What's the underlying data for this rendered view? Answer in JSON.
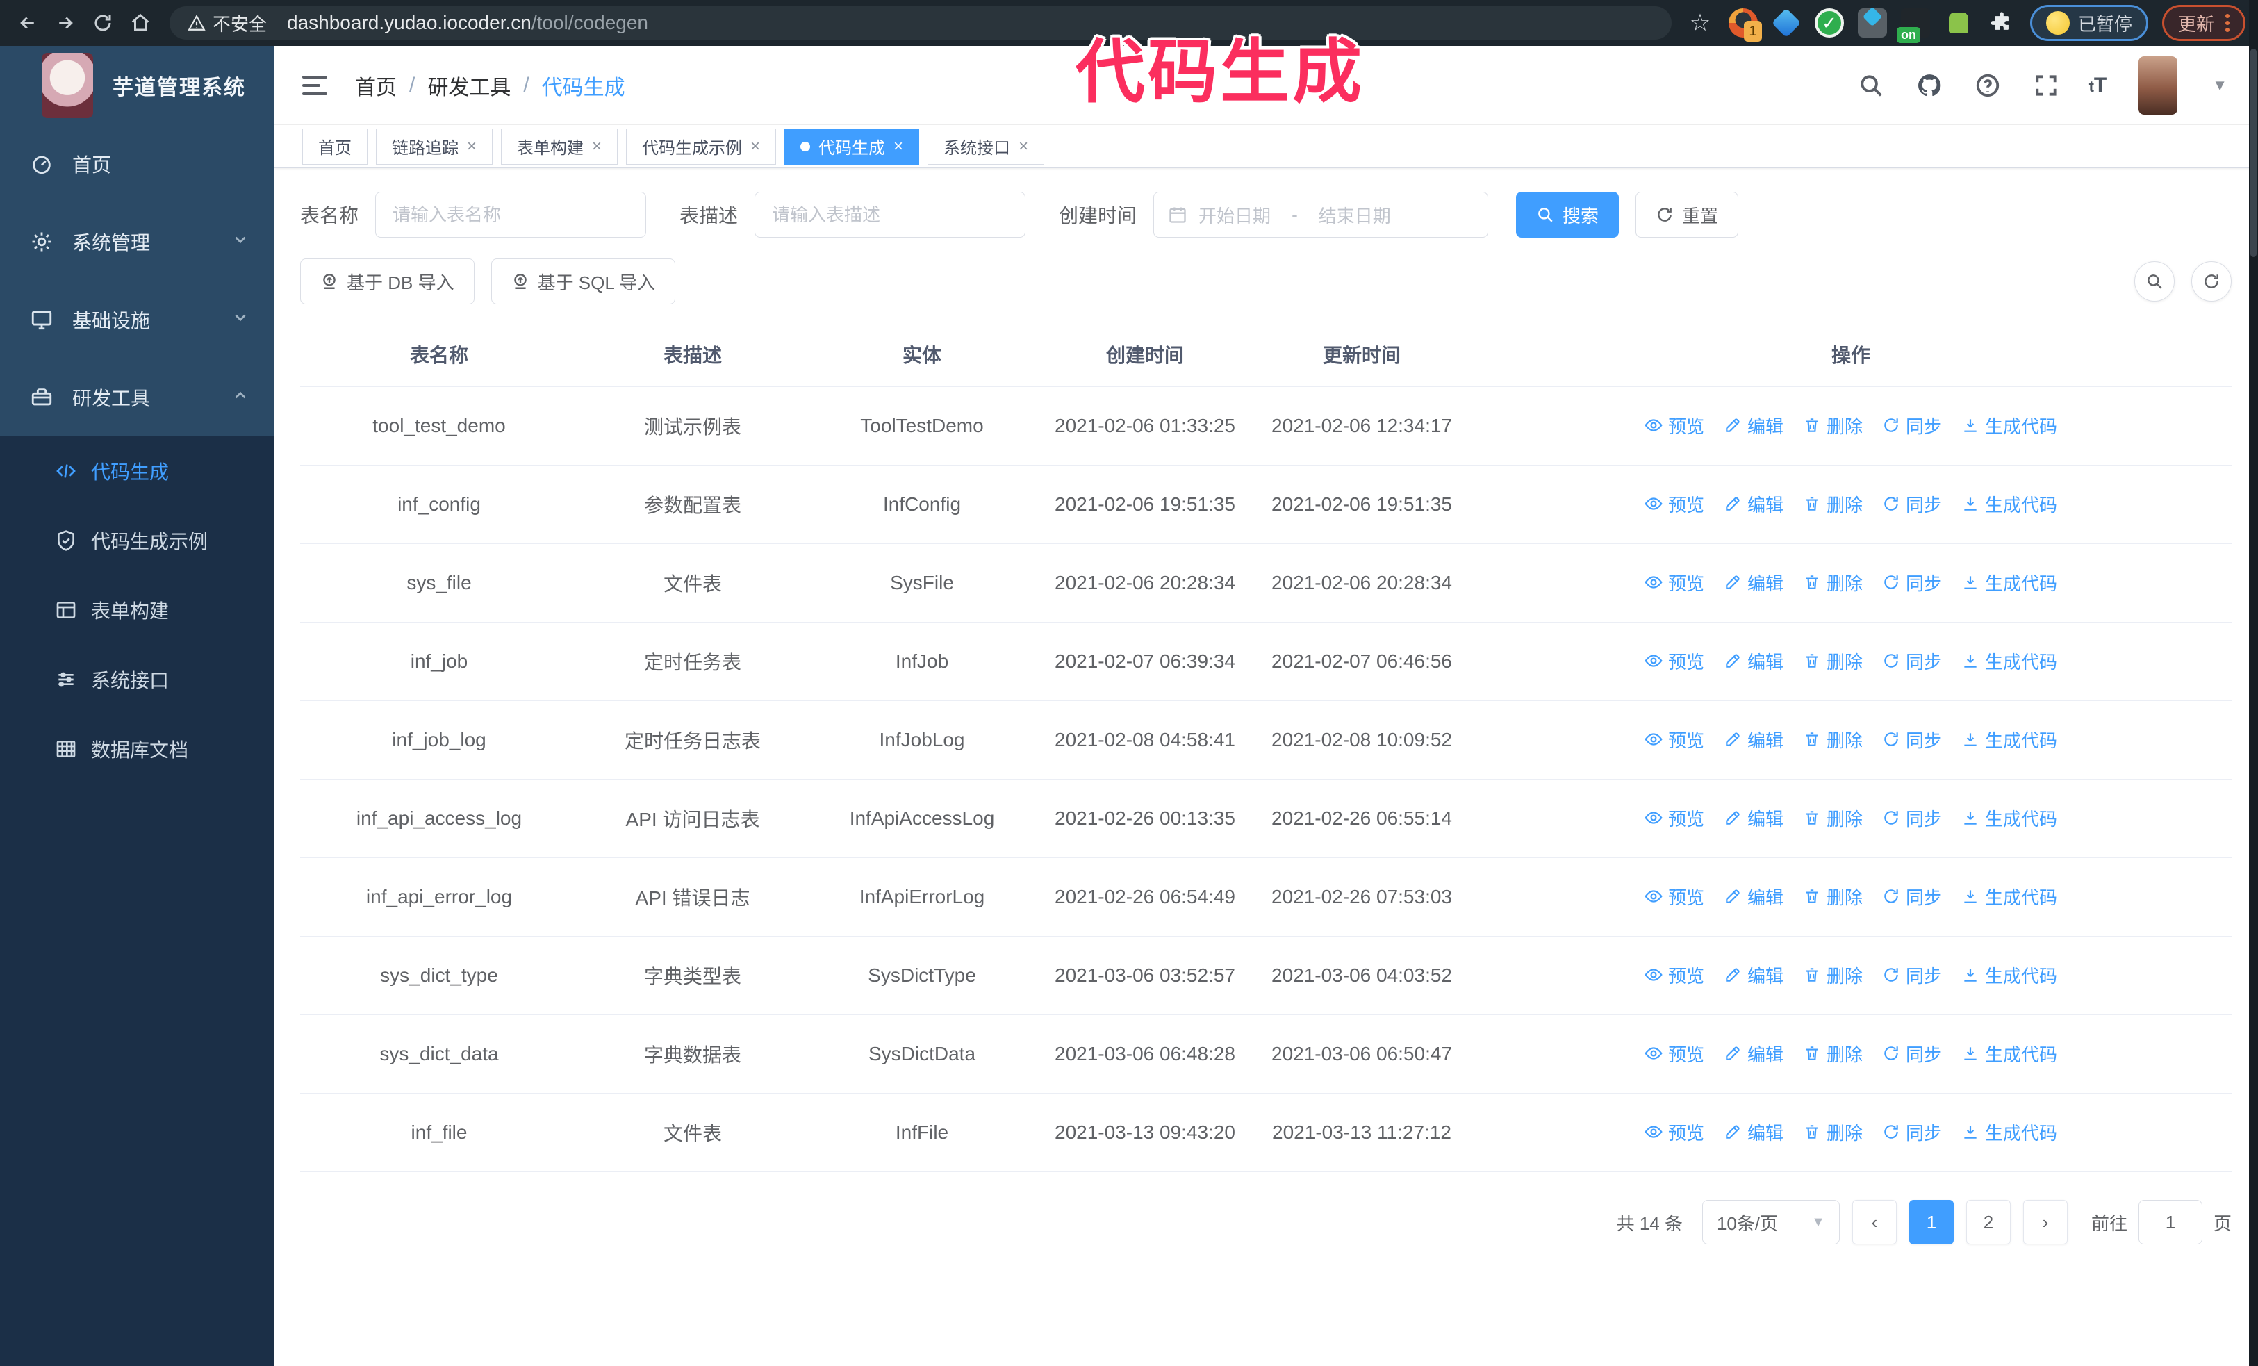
{
  "browser": {
    "security_label": "不安全",
    "url_host": "dashboard.yudao.iocoder.cn",
    "url_path": "/tool/codegen",
    "paused_badge": "已暂停",
    "update_button": "更新"
  },
  "annotation": {
    "text": "代码生成",
    "color": "#fb2e5e"
  },
  "app": {
    "title": "芋道管理系统"
  },
  "breadcrumb": {
    "items": [
      "首页",
      "研发工具",
      "代码生成"
    ],
    "separator": "/"
  },
  "tabs": [
    {
      "label": "首页",
      "closable": false,
      "active": false
    },
    {
      "label": "链路追踪",
      "closable": true,
      "active": false
    },
    {
      "label": "表单构建",
      "closable": true,
      "active": false
    },
    {
      "label": "代码生成示例",
      "closable": true,
      "active": false
    },
    {
      "label": "代码生成",
      "closable": true,
      "active": true
    },
    {
      "label": "系统接口",
      "closable": true,
      "active": false
    }
  ],
  "sidebar": {
    "items": [
      {
        "label": "首页",
        "expandable": false
      },
      {
        "label": "系统管理",
        "expandable": true,
        "state": "collapsed"
      },
      {
        "label": "基础设施",
        "expandable": true,
        "state": "collapsed"
      },
      {
        "label": "研发工具",
        "expandable": true,
        "state": "expanded"
      }
    ],
    "subitems": [
      {
        "label": "代码生成",
        "active": true
      },
      {
        "label": "代码生成示例",
        "active": false
      },
      {
        "label": "表单构建",
        "active": false
      },
      {
        "label": "系统接口",
        "active": false
      },
      {
        "label": "数据库文档",
        "active": false
      }
    ]
  },
  "filters": {
    "name_label": "表名称",
    "name_placeholder": "请输入表名称",
    "desc_label": "表描述",
    "desc_placeholder": "请输入表描述",
    "time_label": "创建时间",
    "start_placeholder": "开始日期",
    "range_separator": "-",
    "end_placeholder": "结束日期",
    "search_button": "搜索",
    "reset_button": "重置"
  },
  "toolbar": {
    "db_import_button": "基于 DB 导入",
    "sql_import_button": "基于 SQL 导入"
  },
  "table": {
    "headers": [
      "表名称",
      "表描述",
      "实体",
      "创建时间",
      "更新时间",
      "操作"
    ],
    "actions": [
      {
        "name": "preview",
        "label": "预览"
      },
      {
        "name": "edit",
        "label": "编辑"
      },
      {
        "name": "delete",
        "label": "删除"
      },
      {
        "name": "sync",
        "label": "同步"
      },
      {
        "name": "generate",
        "label": "生成代码"
      }
    ],
    "rows": [
      {
        "name": "tool_test_demo",
        "desc": "测试示例表",
        "entity": "ToolTestDemo",
        "created": "2021-02-06 01:33:25",
        "updated": "2021-02-06 12:34:17"
      },
      {
        "name": "inf_config",
        "desc": "参数配置表",
        "entity": "InfConfig",
        "created": "2021-02-06 19:51:35",
        "updated": "2021-02-06 19:51:35"
      },
      {
        "name": "sys_file",
        "desc": "文件表",
        "entity": "SysFile",
        "created": "2021-02-06 20:28:34",
        "updated": "2021-02-06 20:28:34"
      },
      {
        "name": "inf_job",
        "desc": "定时任务表",
        "entity": "InfJob",
        "created": "2021-02-07 06:39:34",
        "updated": "2021-02-07 06:46:56"
      },
      {
        "name": "inf_job_log",
        "desc": "定时任务日志表",
        "entity": "InfJobLog",
        "created": "2021-02-08 04:58:41",
        "updated": "2021-02-08 10:09:52"
      },
      {
        "name": "inf_api_access_log",
        "desc": "API 访问日志表",
        "entity": "InfApiAccessLog",
        "created": "2021-02-26 00:13:35",
        "updated": "2021-02-26 06:55:14"
      },
      {
        "name": "inf_api_error_log",
        "desc": "API 错误日志",
        "entity": "InfApiErrorLog",
        "created": "2021-02-26 06:54:49",
        "updated": "2021-02-26 07:53:03"
      },
      {
        "name": "sys_dict_type",
        "desc": "字典类型表",
        "entity": "SysDictType",
        "created": "2021-03-06 03:52:57",
        "updated": "2021-03-06 04:03:52"
      },
      {
        "name": "sys_dict_data",
        "desc": "字典数据表",
        "entity": "SysDictData",
        "created": "2021-03-06 06:48:28",
        "updated": "2021-03-06 06:50:47"
      },
      {
        "name": "inf_file",
        "desc": "文件表",
        "entity": "InfFile",
        "created": "2021-03-13 09:43:20",
        "updated": "2021-03-13 11:27:12"
      }
    ]
  },
  "pagination": {
    "total": "共 14 条",
    "page_size": "10条/页",
    "pages": [
      "1",
      "2"
    ],
    "active_page": "1",
    "goto_label": "前往",
    "goto_value": "1",
    "unit_label": "页"
  }
}
